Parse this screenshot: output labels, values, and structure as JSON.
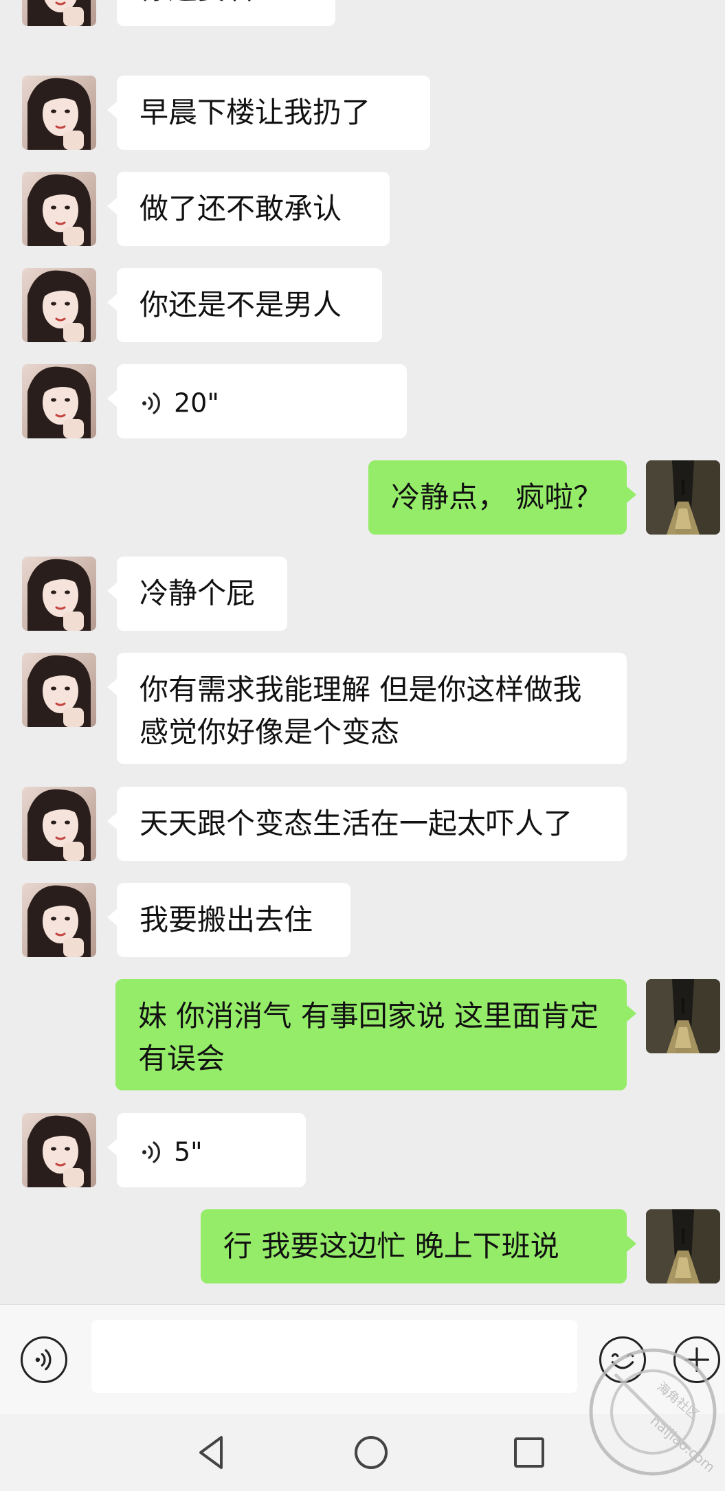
{
  "colors": {
    "background": "#ededed",
    "incoming_bubble": "#ffffff",
    "outgoing_bubble": "#95ec69",
    "input_bar": "#f7f7f7"
  },
  "messages": [
    {
      "sender": "contact",
      "type": "text",
      "text": "你还要看？"
    },
    {
      "sender": "contact",
      "type": "text",
      "text": "早晨下楼让我扔了"
    },
    {
      "sender": "contact",
      "type": "text",
      "text": "做了还不敢承认"
    },
    {
      "sender": "contact",
      "type": "text",
      "text": "你还是不是男人"
    },
    {
      "sender": "contact",
      "type": "voice",
      "duration": "20\""
    },
    {
      "sender": "me",
      "type": "text",
      "text": "冷静点， 疯啦？"
    },
    {
      "sender": "contact",
      "type": "text",
      "text": "冷静个屁"
    },
    {
      "sender": "contact",
      "type": "text",
      "text": "你有需求我能理解  但是你这样做我感觉你好像是个变态"
    },
    {
      "sender": "contact",
      "type": "text",
      "text": "天天跟个变态生活在一起太吓人了"
    },
    {
      "sender": "contact",
      "type": "text",
      "text": "我要搬出去住"
    },
    {
      "sender": "me",
      "type": "text",
      "text": "妹 你消消气  有事回家说 这里面肯定有误会"
    },
    {
      "sender": "contact",
      "type": "voice",
      "duration": "5\""
    },
    {
      "sender": "me",
      "type": "text",
      "text": "行  我要这边忙  晚上下班说"
    }
  ],
  "input_bar": {
    "voice_icon": "voice-icon",
    "text_value": "",
    "emoji_icon": "emoji-icon",
    "plus_icon": "plus-icon"
  },
  "nav_bar": {
    "back_icon": "back-triangle-icon",
    "home_icon": "home-circle-icon",
    "recents_icon": "recents-square-icon"
  },
  "watermark": {
    "site": "haijiao.com",
    "label": "海角社区"
  }
}
